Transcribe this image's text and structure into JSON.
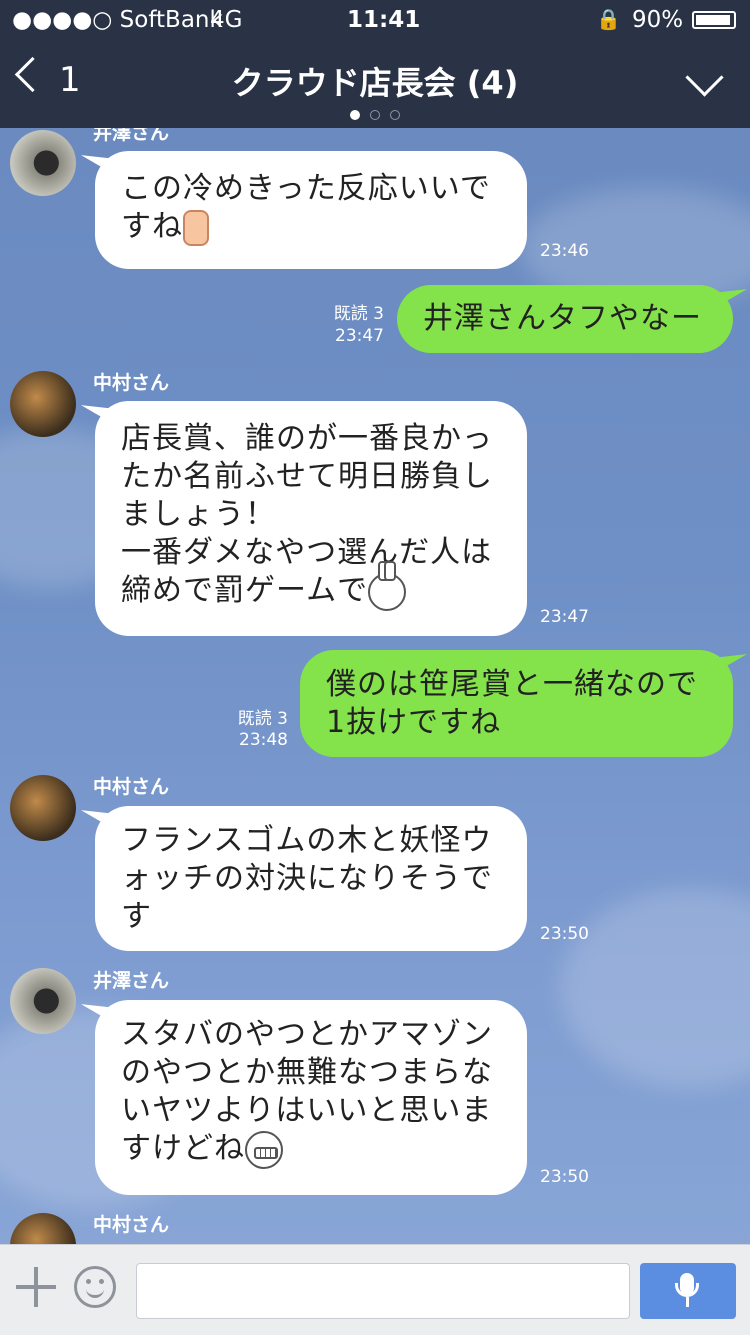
{
  "status_bar": {
    "carrier": "●●●●○ SoftBank",
    "network": "4G",
    "time": "11:41",
    "battery": "90%"
  },
  "header": {
    "back_count": "1",
    "title": "クラウド店長会 (4)"
  },
  "messages": [
    {
      "side": "left",
      "sender": "井澤さん",
      "text": "この冷めきった反応いいで\nすね",
      "emoji": "thumbs-up",
      "time": "23:46"
    },
    {
      "side": "right",
      "read": "既読 3",
      "time": "23:47",
      "text": "井澤さんタフやなー"
    },
    {
      "side": "left",
      "sender": "中村さん",
      "text": "店長賞、誰のが一番良かっ\nたか名前ふせて明日勝負し\nましょう！\n一番ダメなやつ選んだ人は\n締めで罰ゲームで",
      "emoji": "bunny",
      "time": "23:47"
    },
    {
      "side": "right",
      "read": "既読 3",
      "time": "23:48",
      "text": "僕のは笹尾賞と一緒なので\n1抜けですね"
    },
    {
      "side": "left",
      "sender": "中村さん",
      "text": "フランスゴムの木と妖怪ウ\nォッチの対決になりそうで\nす",
      "time": "23:50"
    },
    {
      "side": "left",
      "sender": "井澤さん",
      "text": "スタバのやつとかアマゾン\nのやつとか無難なつまらな\nいヤツよりはいいと思いま\nすけどね",
      "emoji": "grin",
      "time": "23:50"
    },
    {
      "side": "left",
      "sender": "中村さん"
    }
  ],
  "input": {
    "placeholder": ""
  }
}
